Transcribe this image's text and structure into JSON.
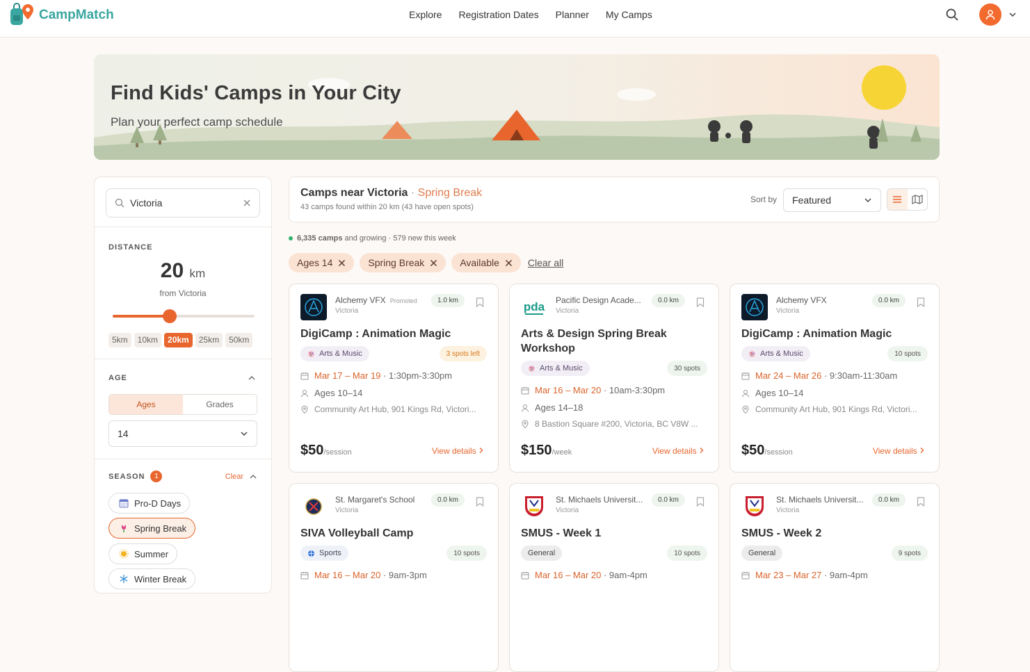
{
  "brand": {
    "name": "CampMatch"
  },
  "nav": {
    "items": [
      "Explore",
      "Registration Dates",
      "Planner",
      "My Camps"
    ]
  },
  "hero": {
    "title": "Find Kids' Camps in Your City",
    "subtitle": "Plan your perfect camp schedule"
  },
  "sidebar": {
    "search_value": "Victoria",
    "distance": {
      "label": "DISTANCE",
      "value": "20",
      "unit": "km",
      "from": "from Victoria",
      "slider_fraction": 0.4,
      "options": [
        "5km",
        "10km",
        "20km",
        "25km",
        "50km"
      ],
      "active_option": "20km"
    },
    "age": {
      "label": "AGE",
      "modes": [
        "Ages",
        "Grades"
      ],
      "active_mode": "Ages",
      "value": "14"
    },
    "season": {
      "label": "SEASON",
      "count": "1",
      "clear": "Clear",
      "options": [
        {
          "label": "Pro-D Days",
          "icon": "calendar-icon",
          "selected": false
        },
        {
          "label": "Spring Break",
          "icon": "tulip-icon",
          "selected": true
        },
        {
          "label": "Summer",
          "icon": "sun-icon",
          "selected": false
        },
        {
          "label": "Winter Break",
          "icon": "snowflake-icon",
          "selected": false
        }
      ]
    }
  },
  "results": {
    "title": "Camps near Victoria",
    "separator": "·",
    "season": "Spring Break",
    "summary": "43 camps found within 20 km (43 have open spots)",
    "sort_label": "Sort by",
    "sort_value": "Featured",
    "stats": {
      "count": "6,335 camps",
      "tail": "and growing · 579 new this week"
    },
    "filters": [
      "Ages 14",
      "Spring Break",
      "Available"
    ],
    "clear_all": "Clear all"
  },
  "cards": [
    {
      "provider": "Alchemy VFX",
      "promoted": "Promoted",
      "city": "Victoria",
      "distance": "1.0 km",
      "logo": "alchemy",
      "title": "DigiCamp : Animation Magic",
      "category": "Arts & Music",
      "cat_type": "arts",
      "spots": "3 spots left",
      "spots_warn": true,
      "dates": "Mar 17 – Mar 19",
      "time": " · 1:30pm-3:30pm",
      "ages": "Ages 10–14",
      "location": "Community Art Hub, 901 Kings Rd, Victori...",
      "price": "$50",
      "unit": "/session",
      "view": "View details"
    },
    {
      "provider": "Pacific Design Acade...",
      "promoted": "",
      "city": "Victoria",
      "distance": "0.0 km",
      "logo": "pda",
      "title": "Arts & Design Spring Break Workshop",
      "category": "Arts & Music",
      "cat_type": "arts",
      "spots": "30 spots",
      "spots_warn": false,
      "dates": "Mar 16 – Mar 20",
      "time": " · 10am-3:30pm",
      "ages": "Ages 14–18",
      "location": "8 Bastion Square #200, Victoria, BC V8W ...",
      "price": "$150",
      "unit": "/week",
      "view": "View details"
    },
    {
      "provider": "Alchemy VFX",
      "promoted": "",
      "city": "Victoria",
      "distance": "0.0 km",
      "logo": "alchemy",
      "title": "DigiCamp : Animation Magic",
      "category": "Arts & Music",
      "cat_type": "arts",
      "spots": "10 spots",
      "spots_warn": false,
      "dates": "Mar 24 – Mar 26",
      "time": " · 9:30am-11:30am",
      "ages": "Ages 10–14",
      "location": "Community Art Hub, 901 Kings Rd, Victori...",
      "price": "$50",
      "unit": "/session",
      "view": "View details"
    },
    {
      "provider": "St. Margaret's School",
      "promoted": "",
      "city": "Victoria",
      "distance": "0.0 km",
      "logo": "stm",
      "title": "SIVA Volleyball Camp",
      "category": "Sports",
      "cat_type": "sports",
      "spots": "10 spots",
      "spots_warn": false,
      "dates": "Mar 16 – Mar 20",
      "time": " · 9am-3pm"
    },
    {
      "provider": "St. Michaels Universit...",
      "promoted": "",
      "city": "Victoria",
      "distance": "0.0 km",
      "logo": "smus",
      "title": "SMUS - Week 1",
      "category": "General",
      "cat_type": "general",
      "spots": "10 spots",
      "spots_warn": false,
      "dates": "Mar 16 – Mar 20",
      "time": " · 9am-4pm"
    },
    {
      "provider": "St. Michaels Universit...",
      "promoted": "",
      "city": "Victoria",
      "distance": "0.0 km",
      "logo": "smus",
      "title": "SMUS - Week 2",
      "category": "General",
      "cat_type": "general",
      "spots": "9 spots",
      "spots_warn": false,
      "dates": "Mar 23 – Mar 27",
      "time": " · 9am-4pm"
    }
  ],
  "colors": {
    "accent": "#e8662e",
    "brand": "#3aa6a0"
  }
}
